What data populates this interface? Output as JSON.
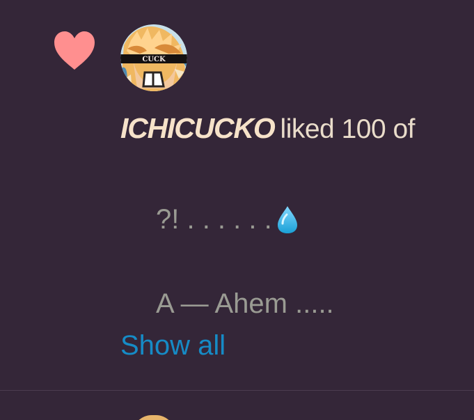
{
  "notification": {
    "icon": "heart-icon",
    "heart_color": "#ff8f8f",
    "avatar_band_text": "CUCK",
    "username": "ICHICUCKO",
    "action_text": "liked 100 of",
    "quote_lines": [
      "?! . . . . . .",
      "A — Ahem ....."
    ],
    "emoji": "water-drop-icon",
    "show_all": "Show all"
  },
  "colors": {
    "background": "#342638",
    "username": "#f6e2c9",
    "action_text": "#e9dcca",
    "quote_text": "#9a9b93",
    "link": "#168bc6",
    "divider": "#4c3c50"
  }
}
